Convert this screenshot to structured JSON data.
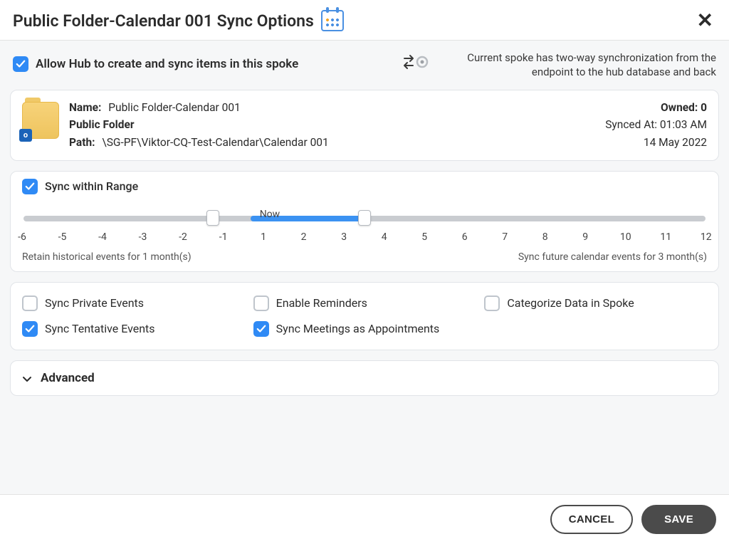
{
  "dialog": {
    "title": "Public Folder-Calendar 001 Sync Options"
  },
  "allow_sync": {
    "label": "Allow Hub to create and sync items in this spoke",
    "checked": true
  },
  "sync_mode": {
    "description": "Current spoke has two-way synchronization from the endpoint to the hub database and back"
  },
  "info": {
    "name_label": "Name:",
    "name_value": "Public Folder-Calendar 001",
    "type_label": "Public Folder",
    "path_label": "Path:",
    "path_value": "\\SG-PF\\Viktor-CQ-Test-Calendar\\Calendar 001",
    "owned_label": "Owned:",
    "owned_value": "0",
    "synced_label": "Synced At:",
    "synced_time": "01:03 AM",
    "synced_date": "14 May 2022"
  },
  "range": {
    "label": "Sync within Range",
    "checked": true,
    "now_label": "Now",
    "min": -6,
    "max": 12,
    "left_value": -1,
    "right_value": 3,
    "ticks": [
      "-6",
      "-5",
      "-4",
      "-3",
      "-2",
      "-1",
      "1",
      "2",
      "3",
      "4",
      "5",
      "6",
      "7",
      "8",
      "9",
      "10",
      "11",
      "12"
    ],
    "retain_text": "Retain historical events for 1 month(s)",
    "future_text": "Sync future calendar events for 3 month(s)"
  },
  "options": {
    "sync_private": {
      "label": "Sync Private Events",
      "checked": false
    },
    "sync_tentative": {
      "label": "Sync Tentative Events",
      "checked": true
    },
    "enable_reminders": {
      "label": "Enable Reminders",
      "checked": false
    },
    "sync_meetings": {
      "label": "Sync Meetings as Appointments",
      "checked": true
    },
    "categorize": {
      "label": "Categorize Data in Spoke",
      "checked": false
    }
  },
  "advanced": {
    "label": "Advanced"
  },
  "footer": {
    "cancel": "CANCEL",
    "save": "SAVE"
  }
}
